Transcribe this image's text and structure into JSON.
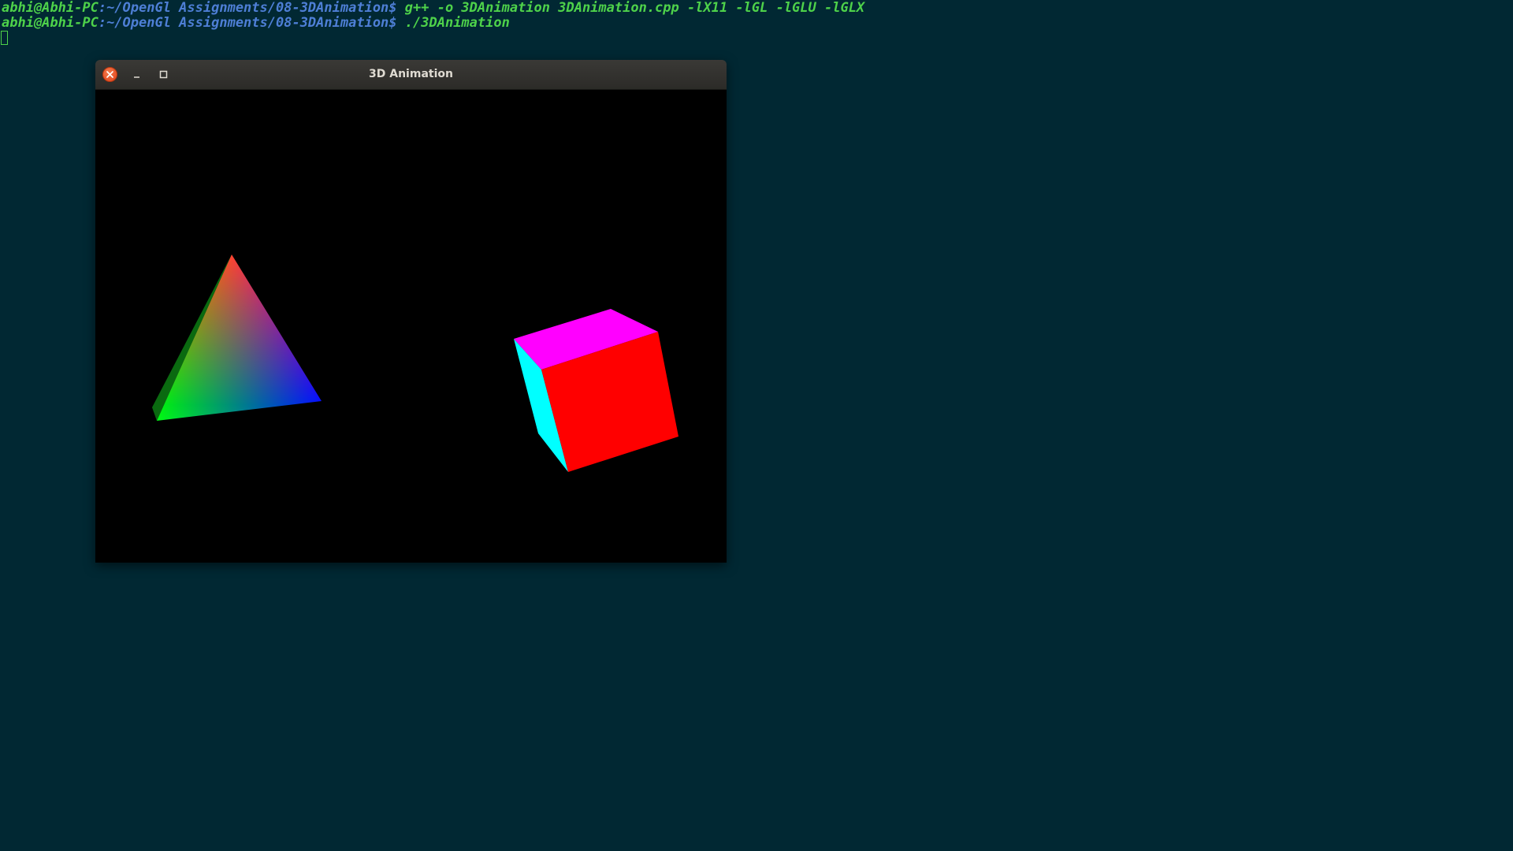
{
  "terminal": {
    "background": "#012833",
    "lines": [
      {
        "user_host": "abhi@Abhi-PC",
        "path": ":~/OpenGl Assignments/08-3DAnimation",
        "prompt": "$ ",
        "command": "g++ -o 3DAnimation 3DAnimation.cpp -lX11 -lGL -lGLU -lGLX"
      },
      {
        "user_host": "abhi@Abhi-PC",
        "path": ":~/OpenGl Assignments/08-3DAnimation",
        "prompt": "$ ",
        "command": "./3DAnimation"
      }
    ]
  },
  "window": {
    "title": "3D Animation",
    "close_icon": "close-icon",
    "minimize_icon": "minimize-icon",
    "maximize_icon": "maximize-icon"
  },
  "scene": {
    "background": "#000000",
    "pyramid": {
      "apex_color": "#ff0000",
      "left_color": "#00ff00",
      "right_color": "#0000ff"
    },
    "cube": {
      "top_color": "#ff00ff",
      "front_color": "#ff0000",
      "side_color": "#00ffff"
    }
  }
}
